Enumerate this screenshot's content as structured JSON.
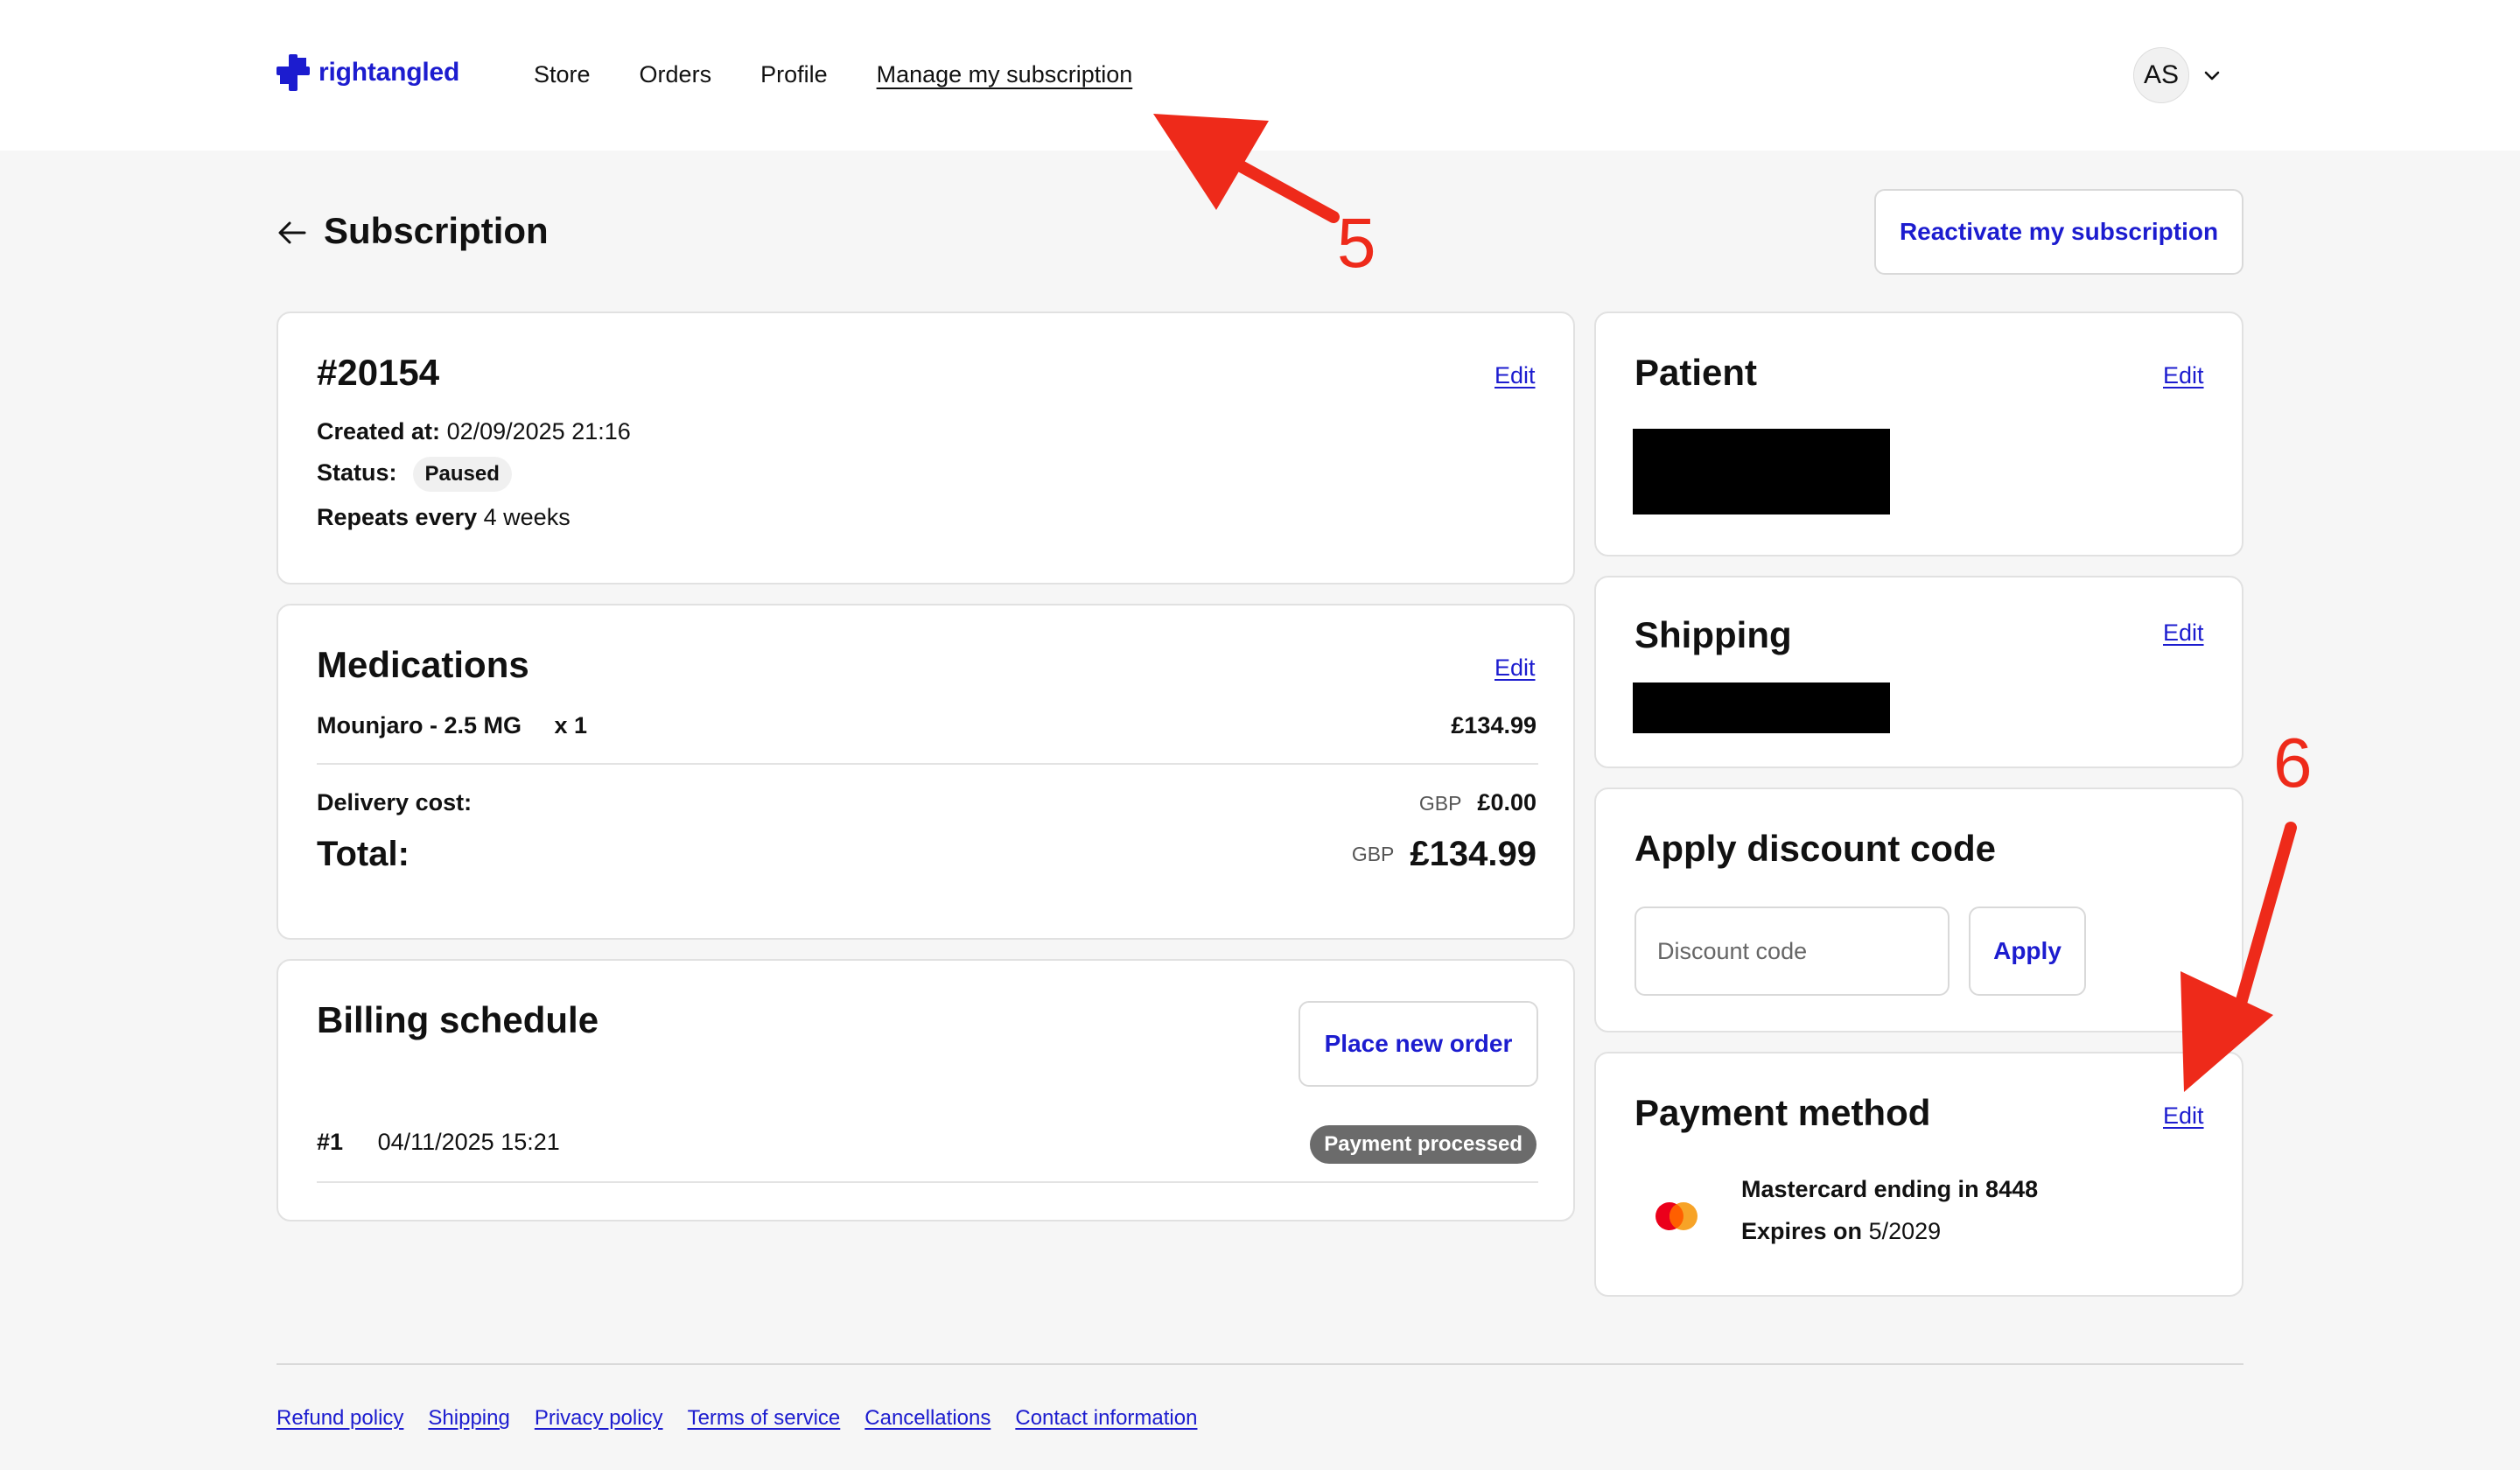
{
  "brand": {
    "name": "rightangled",
    "color": "#1c1ccf"
  },
  "nav": {
    "items": [
      "Store",
      "Orders",
      "Profile",
      "Manage my subscription"
    ],
    "active": "Manage my subscription"
  },
  "user": {
    "initials": "AS"
  },
  "page": {
    "title": "Subscription",
    "reactivate_label": "Reactivate my subscription"
  },
  "subscription": {
    "number": "#20154",
    "edit_label": "Edit",
    "created_label": "Created at:",
    "created_value": "02/09/2025 21:16",
    "status_label": "Status:",
    "status_value": "Paused",
    "repeats_label": "Repeats every",
    "repeats_value": "4 weeks"
  },
  "medications": {
    "title": "Medications",
    "edit_label": "Edit",
    "item_name": "Mounjaro - 2.5 MG",
    "item_qty": "x 1",
    "item_price": "£134.99",
    "delivery_label": "Delivery cost:",
    "delivery_currency": "GBP",
    "delivery_value": "£0.00",
    "total_label": "Total:",
    "total_currency": "GBP",
    "total_value": "£134.99"
  },
  "billing": {
    "title": "Billing schedule",
    "place_order_label": "Place new order",
    "rows": [
      {
        "index": "#1",
        "date": "04/11/2025 15:21",
        "status": "Payment processed"
      }
    ]
  },
  "patient": {
    "title": "Patient",
    "edit_label": "Edit"
  },
  "shipping": {
    "title": "Shipping",
    "edit_label": "Edit"
  },
  "discount": {
    "title": "Apply discount code",
    "placeholder": "Discount code",
    "apply_label": "Apply"
  },
  "payment": {
    "title": "Payment method",
    "edit_label": "Edit",
    "card_line": "Mastercard ending in 8448",
    "expires_label": "Expires on",
    "expires_value": "5/2029"
  },
  "annotations": {
    "first": "5",
    "second": "6",
    "color": "#ee2a1a"
  },
  "footer": {
    "links": [
      "Refund policy",
      "Shipping",
      "Privacy policy",
      "Terms of service",
      "Cancellations",
      "Contact information"
    ]
  }
}
